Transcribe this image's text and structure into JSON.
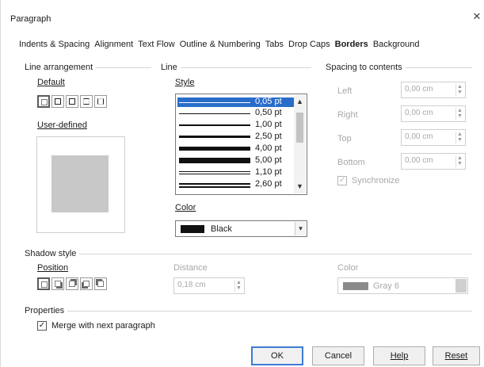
{
  "window": {
    "title": "Paragraph",
    "close_glyph": "✕"
  },
  "tabs": [
    {
      "label": "Indents & Spacing"
    },
    {
      "label": "Alignment"
    },
    {
      "label": "Text Flow"
    },
    {
      "label": "Outline & Numbering"
    },
    {
      "label": "Tabs"
    },
    {
      "label": "Drop Caps"
    },
    {
      "label": "Borders",
      "active": true
    },
    {
      "label": "Background"
    }
  ],
  "line_arrangement": {
    "label": "Line arrangement",
    "default_label": "Default",
    "user_defined_label": "User-defined"
  },
  "line": {
    "label": "Line",
    "style_label": "Style",
    "styles": [
      {
        "label": "0,05 pt",
        "selected": true
      },
      {
        "label": "0,50 pt"
      },
      {
        "label": "1,00 pt"
      },
      {
        "label": "2,50 pt"
      },
      {
        "label": "4,00 pt"
      },
      {
        "label": "5,00 pt"
      },
      {
        "label": "1,10 pt"
      },
      {
        "label": "2,60 pt"
      }
    ],
    "color_label": "Color",
    "color_value": "Black",
    "color_swatch": "#111111"
  },
  "spacing": {
    "label": "Spacing to contents",
    "left_label": "Left",
    "left_value": "0,00 cm",
    "right_label": "Right",
    "right_value": "0,00 cm",
    "top_label": "Top",
    "top_value": "0,00 cm",
    "bottom_label": "Bottom",
    "bottom_value": "0,00 cm",
    "synchronize_label": "Synchronize",
    "synchronize_checked": true
  },
  "shadow": {
    "label": "Shadow style",
    "position_label": "Position",
    "distance_label": "Distance",
    "distance_value": "0,18 cm",
    "color_label": "Color",
    "color_value": "Gray 6",
    "color_swatch": "#8a8a8a"
  },
  "properties": {
    "label": "Properties",
    "merge_label": "Merge with next paragraph",
    "merge_checked": true
  },
  "buttons": {
    "ok": "OK",
    "cancel": "Cancel",
    "help": "Help",
    "reset": "Reset"
  }
}
